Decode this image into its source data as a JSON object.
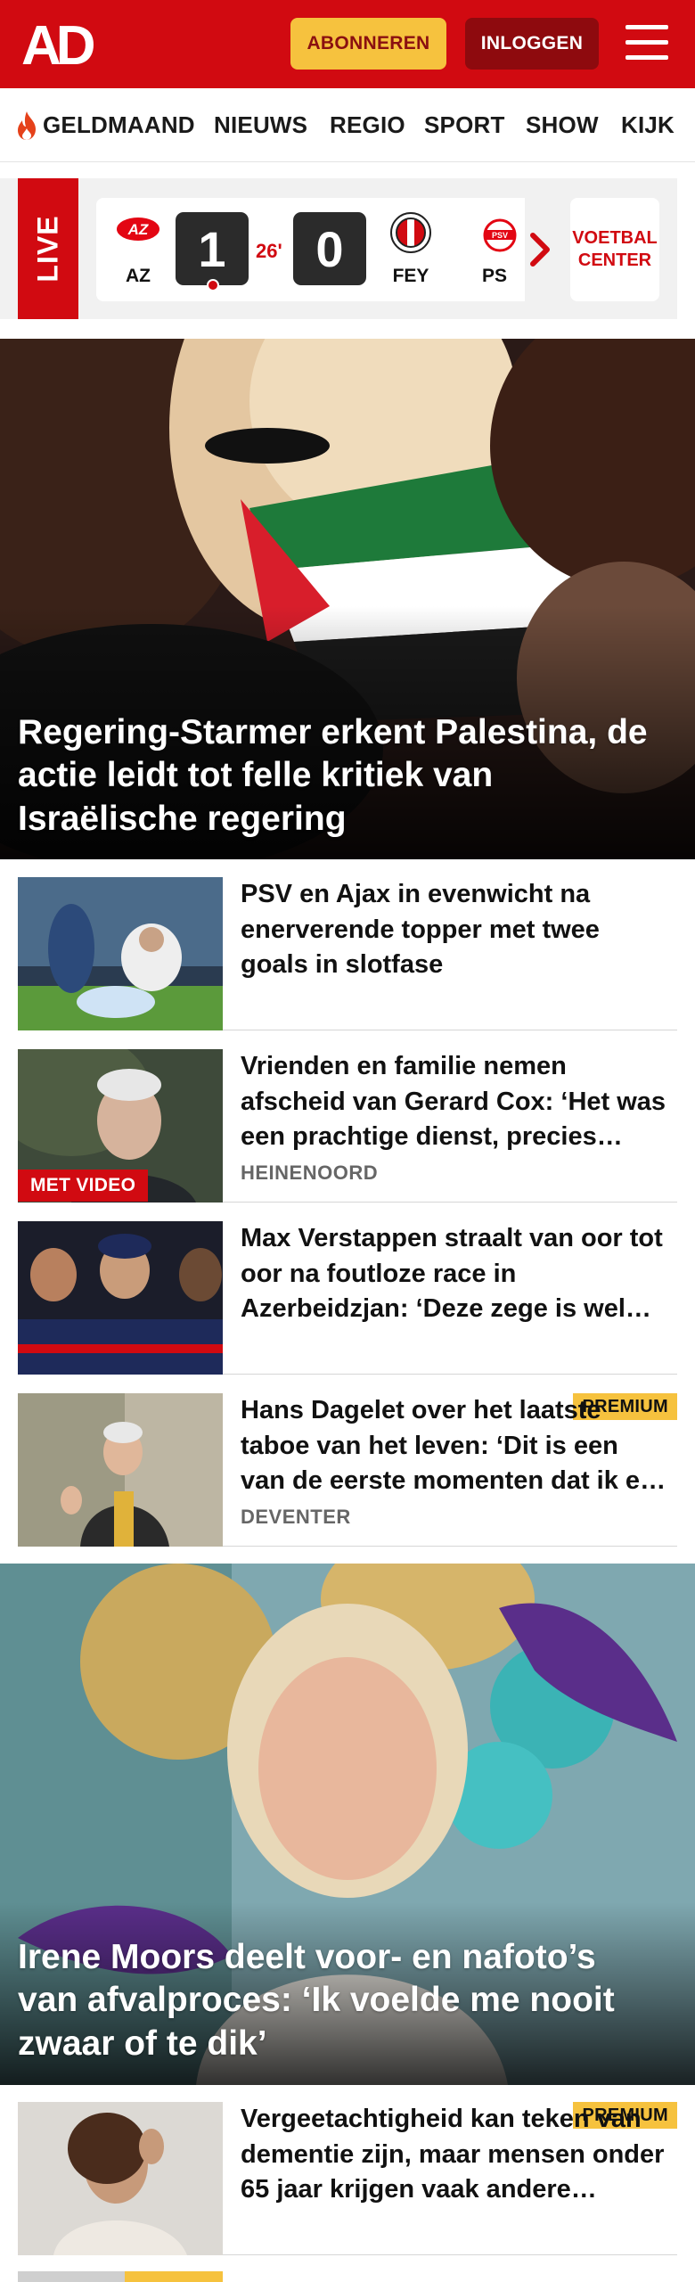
{
  "header": {
    "logo_text": "AD",
    "subscribe_label": "ABONNEREN",
    "login_label": "INLOGGEN",
    "brand_color": "#d10a11",
    "subscribe_color": "#f6c23e",
    "menu_icon": "hamburger-menu-icon"
  },
  "nav": {
    "items": [
      {
        "label": "GELDMAAND",
        "icon": "flame-icon"
      },
      {
        "label": "NIEUWS"
      },
      {
        "label": "REGIO"
      },
      {
        "label": "SPORT"
      },
      {
        "label": "SHOW"
      },
      {
        "label": "KIJK"
      }
    ]
  },
  "live": {
    "label": "LIVE",
    "match": {
      "home": "AZ",
      "away": "FEY",
      "home_score": "1",
      "away_score": "0",
      "minute": "26'"
    },
    "next_team": "PS",
    "voetbal_center": "VOETBAL CENTER"
  },
  "articles": [
    {
      "type": "hero",
      "title": "Regering-Starmer erkent Palestina, de actie leidt tot felle kritiek van Israëlische regering"
    },
    {
      "type": "list",
      "title": "PSV en Ajax in evenwicht na enerverende topper met twee goals in slotfase"
    },
    {
      "type": "list",
      "title": "Vrienden en familie nemen afscheid van Gerard Cox: ‘Het was een prachtige dienst, precies zoals hij het wilde’",
      "location": "HEINENOORD",
      "badge": "MET VIDEO"
    },
    {
      "type": "list",
      "title": "Max Verstappen straalt van oor tot oor na foutloze race in Azerbeidzjan: ‘Deze zege is wel heel bijzonder’"
    },
    {
      "type": "list",
      "title": "Hans Dagelet over het laatste taboe van het leven: ‘Dit is een van de eerste momenten dat ik er echt over praat’",
      "location": "DEVENTER",
      "badge": "PREMIUM"
    },
    {
      "type": "hero",
      "title": "Irene Moors deelt voor- en nafoto’s van afvalproces: ‘Ik voelde me nooit zwaar of te dik’"
    },
    {
      "type": "list",
      "title": "Vergeetachtigheid kan teken van dementie zijn, maar mensen onder 65 jaar krijgen vaak andere diagnose",
      "badge": "PREMIUM"
    }
  ]
}
